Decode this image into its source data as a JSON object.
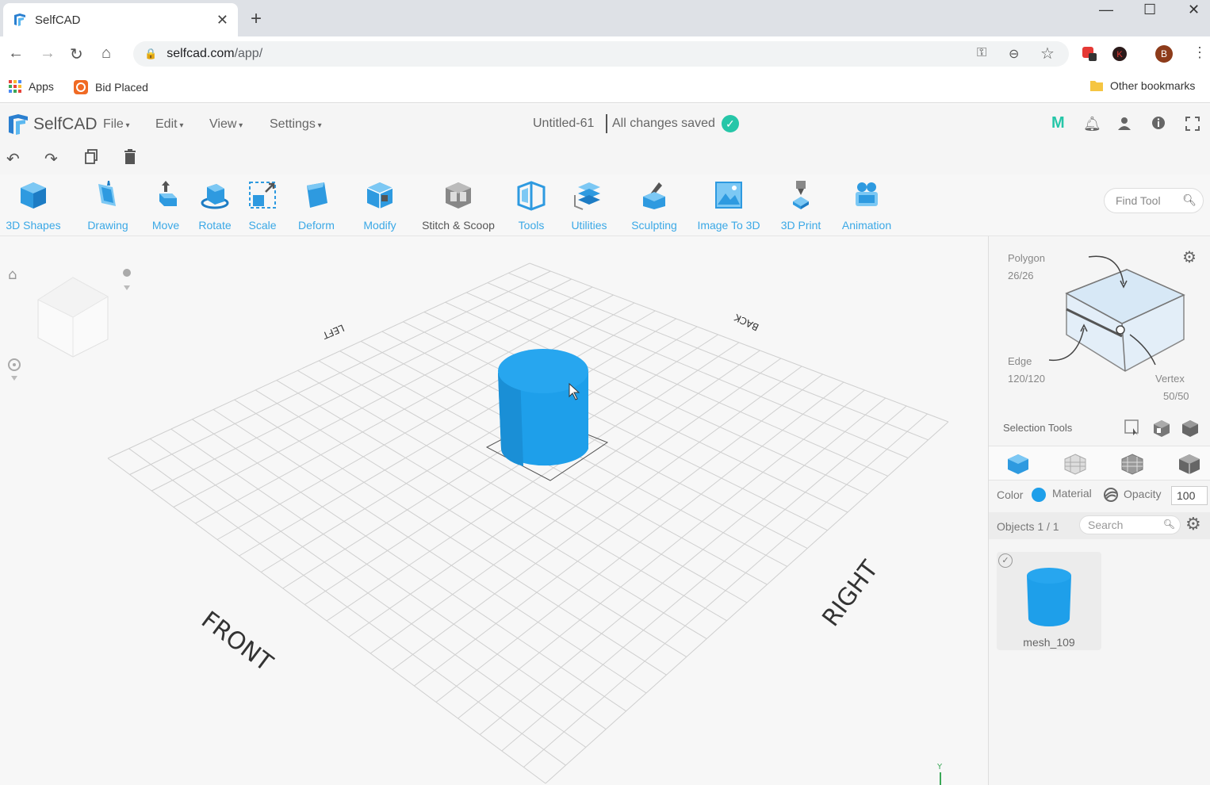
{
  "browser": {
    "tab_title": "SelfCAD",
    "url_host": "selfcad.com",
    "url_path": "/app/",
    "bookmarks": [
      {
        "label": "Apps"
      },
      {
        "label": "Bid Placed"
      }
    ],
    "other_bookmarks": "Other bookmarks",
    "profile_initial": "B"
  },
  "app": {
    "logo_text": "SelfCAD",
    "menus": [
      "File",
      "Edit",
      "View",
      "Settings"
    ],
    "document_name": "Untitled-61",
    "save_status": "All changes saved",
    "accent_color": "#3aa8e6"
  },
  "toolbar": {
    "tools": [
      {
        "label": "3D Shapes",
        "dropdown": true
      },
      {
        "label": "Drawing",
        "dropdown": true
      },
      {
        "label": "Move",
        "dropdown": false
      },
      {
        "label": "Rotate",
        "dropdown": false
      },
      {
        "label": "Scale",
        "dropdown": false
      },
      {
        "label": "Deform",
        "dropdown": true
      },
      {
        "label": "Modify",
        "dropdown": true
      },
      {
        "label": "Stitch & Scoop",
        "dropdown": false
      },
      {
        "label": "Tools",
        "dropdown": true
      },
      {
        "label": "Utilities",
        "dropdown": true
      },
      {
        "label": "Sculpting",
        "dropdown": false
      },
      {
        "label": "Image To 3D",
        "dropdown": false
      },
      {
        "label": "3D Print",
        "dropdown": false
      },
      {
        "label": "Animation",
        "dropdown": false
      }
    ],
    "find_tool_placeholder": "Find Tool"
  },
  "viewport": {
    "labels": {
      "front": "FRONT",
      "right": "RIGHT",
      "left": "LEFT",
      "back": "BACK"
    },
    "axis_label": "Y",
    "object_color": "#1e9fea"
  },
  "panel": {
    "polygon_label": "Polygon",
    "polygon_count": "26/26",
    "edge_label": "Edge",
    "edge_count": "120/120",
    "vertex_label": "Vertex",
    "vertex_count": "50/50",
    "selection_tools_label": "Selection Tools",
    "color_label": "Color",
    "material_label": "Material",
    "opacity_label": "Opacity",
    "opacity_value": "100",
    "objects_label": "Objects 1 / 1",
    "search_placeholder": "Search",
    "objects": [
      {
        "name": "mesh_109"
      }
    ]
  }
}
